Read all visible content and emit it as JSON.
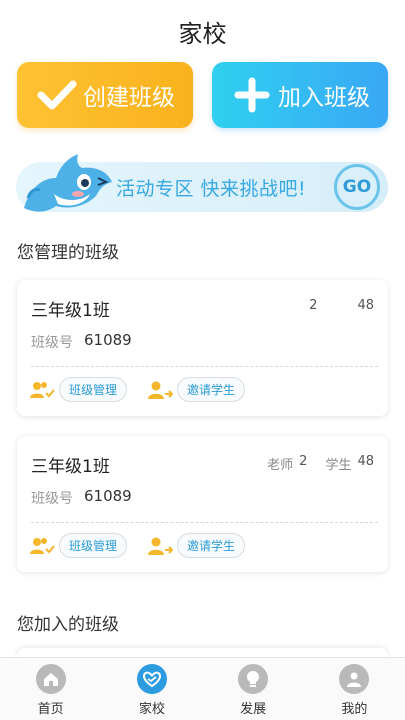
{
  "header": {
    "title": "家校"
  },
  "actions": {
    "create_label": "创建班级",
    "join_label": "加入班级"
  },
  "banner": {
    "text": "活动专区  快来挑战吧!",
    "go_label": "GO"
  },
  "sections": {
    "managed_title": "您管理的班级",
    "joined_title": "您加入的班级"
  },
  "classes": [
    {
      "name": "三年级1班",
      "teacher_label": "",
      "teacher_count": "2",
      "student_label": "",
      "student_count": "48",
      "id_label": "班级号",
      "id": "61089",
      "manage_label": "班级管理",
      "invite_label": "邀请学生"
    },
    {
      "name": "三年级1班",
      "teacher_label": "老师",
      "teacher_count": "2",
      "student_label": "学生",
      "student_count": "48",
      "id_label": "班级号",
      "id": "61089",
      "manage_label": "班级管理",
      "invite_label": "邀请学生"
    }
  ],
  "tabs": [
    {
      "label": "首页",
      "icon": "home-icon"
    },
    {
      "label": "家校",
      "icon": "handshake-heart-icon",
      "active": true
    },
    {
      "label": "发展",
      "icon": "lightbulb-icon"
    },
    {
      "label": "我的",
      "icon": "user-icon"
    }
  ],
  "colors": {
    "create_btn": "#f9b21c",
    "join_btn": "#3aa7f5",
    "accent": "#2a9bd4",
    "tab_active": "#2d9be0",
    "tab_inactive": "#b9b9b9"
  }
}
